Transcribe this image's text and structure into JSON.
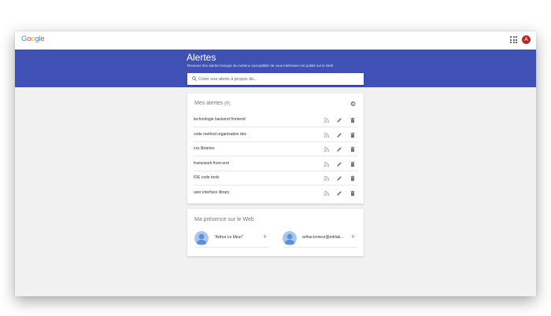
{
  "header": {
    "logo_text": "Google",
    "avatar_letter": "A"
  },
  "banner": {
    "title": "Alertes",
    "subtitle": "Recevez des alertes lorsque du contenu susceptible de vous intéresser est publié sur le Web",
    "search_placeholder": "Créer une alerte à propos de..."
  },
  "alerts": {
    "title": "Mes alertes",
    "count": "(6)",
    "items": [
      {
        "label": "technologie backend frontend"
      },
      {
        "label": "code method organisation dev"
      },
      {
        "label": "css libraries"
      },
      {
        "label": "framework front-end"
      },
      {
        "label": "IDE code tools"
      },
      {
        "label": "user interface library"
      }
    ]
  },
  "presence": {
    "title": "Ma présence sur le Web",
    "people": [
      {
        "name": "\"Arthur Le Meur\"",
        "add": "+"
      },
      {
        "name": "arthur.lemeur@edrlab...",
        "add": "+"
      }
    ]
  },
  "colors": {
    "banner": "#3f51b5",
    "avatar": "#c5221f",
    "background": "#f1f1f1"
  }
}
